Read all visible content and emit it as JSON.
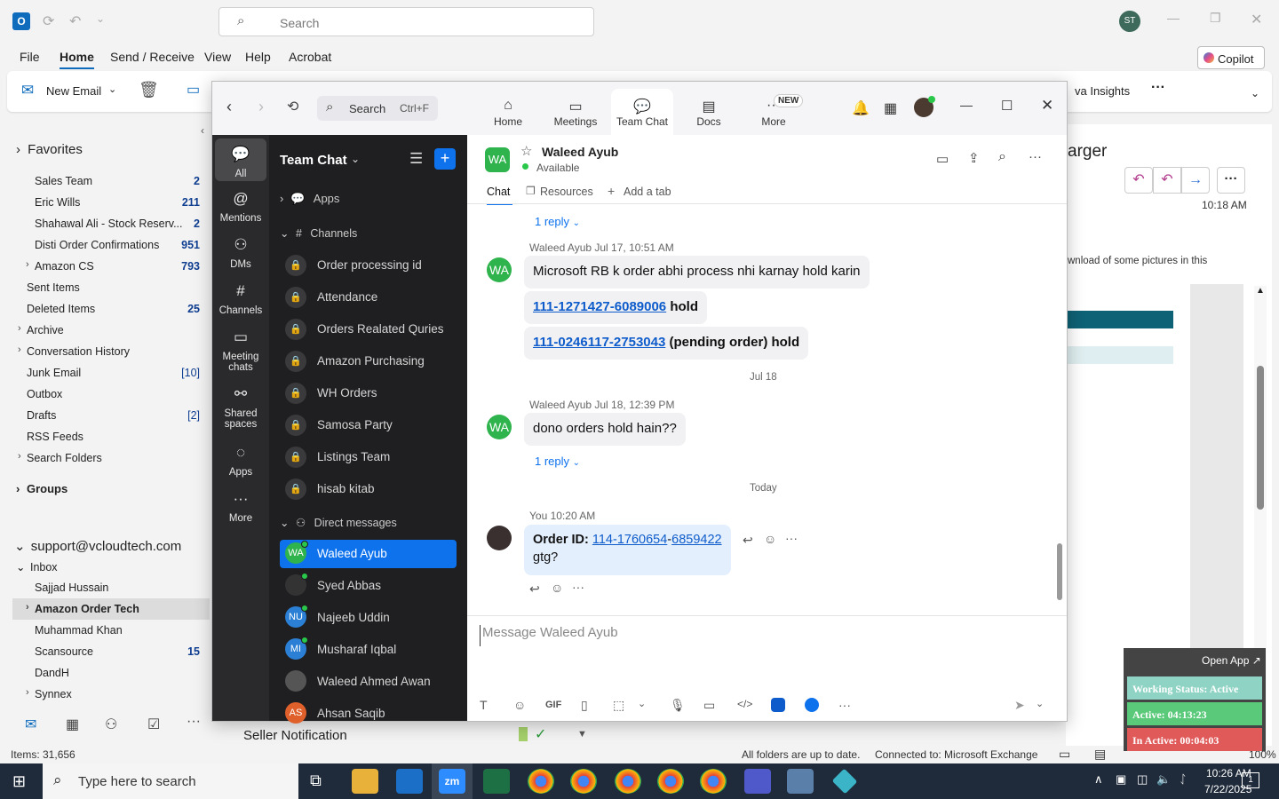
{
  "outlook": {
    "search_placeholder": "Search",
    "avatar": "ST",
    "copilot": "Copilot",
    "menu": [
      "File",
      "Home",
      "Send / Receive",
      "View",
      "Help",
      "Acrobat"
    ],
    "new_email": "New Email",
    "viva_insights": "va Insights",
    "folders_header": "Favorites",
    "favorites": [
      {
        "label": "Sales Team",
        "count": "2"
      },
      {
        "label": "Eric Wills",
        "count": "211"
      },
      {
        "label": "Shahawal Ali - Stock Reserv...",
        "count": "2"
      },
      {
        "label": "Disti Order Confirmations",
        "count": "951"
      },
      {
        "label": "Amazon CS",
        "count": "793"
      },
      {
        "label": "Sent Items",
        "count": ""
      },
      {
        "label": "Deleted Items",
        "count": "25"
      },
      {
        "label": "Archive",
        "count": ""
      },
      {
        "label": "Conversation History",
        "count": ""
      },
      {
        "label": "Junk Email",
        "count": "[10]"
      },
      {
        "label": "Outbox",
        "count": ""
      },
      {
        "label": "Drafts",
        "count": "[2]"
      },
      {
        "label": "RSS Feeds",
        "count": ""
      },
      {
        "label": "Search Folders",
        "count": ""
      }
    ],
    "groups": "Groups",
    "account": "support@vcloudtech.com",
    "inbox": "Inbox",
    "inbox_items": [
      {
        "label": "Sajjad Hussain",
        "count": ""
      },
      {
        "label": "Amazon Order Tech",
        "count": ""
      },
      {
        "label": "Muhammad Khan",
        "count": ""
      },
      {
        "label": "Scansource",
        "count": "15"
      },
      {
        "label": "DandH",
        "count": ""
      },
      {
        "label": "Synnex",
        "count": ""
      }
    ],
    "reading_title": "arger",
    "reading_time": "10:18 AM",
    "reading_text": "wnload of some pictures in this",
    "seller_notification": "Seller Notification",
    "status_items": "Items: 31,656",
    "status_folders": "All folders are up to date.",
    "status_connected": "Connected to: Microsoft Exchange",
    "zoom_pct": "100%"
  },
  "taskbar": {
    "search": "Type here to search",
    "time": "10:26 AM",
    "date": "7/22/2025",
    "notif": "1"
  },
  "zoom": {
    "search": "Search",
    "shortcut": "Ctrl+F",
    "tabs": [
      "Home",
      "Meetings",
      "Team Chat",
      "Docs",
      "More"
    ],
    "new_badge": "NEW",
    "rail": [
      "All",
      "Mentions",
      "DMs",
      "Channels",
      "Meeting chats",
      "Shared spaces",
      "Apps",
      "More"
    ],
    "list_title": "Team Chat",
    "apps": "Apps",
    "channels_header": "Channels",
    "channels": [
      "Order processing id",
      "Attendance",
      "Orders Realated Quries",
      "Amazon Purchasing",
      "WH Orders",
      "Samosa Party",
      "Listings Team",
      "hisab kitab"
    ],
    "dm_header": "Direct messages",
    "dms": [
      {
        "name": "Waleed Ayub",
        "initials": "WA",
        "color": "#2eb34d"
      },
      {
        "name": "Syed Abbas",
        "initials": "",
        "color": "#333"
      },
      {
        "name": "Najeeb Uddin",
        "initials": "NU",
        "color": "#2b7fd4"
      },
      {
        "name": "Musharaf Iqbal",
        "initials": "MI",
        "color": "#2b7fd4"
      },
      {
        "name": "Waleed Ahmed Awan",
        "initials": "",
        "color": "#555"
      },
      {
        "name": "Ahsan Saqib",
        "initials": "AS",
        "color": "#e0602b"
      }
    ],
    "contact": {
      "name": "Waleed Ayub",
      "initials": "WA",
      "status": "Available"
    },
    "chat_tabs": [
      "Chat",
      "Resources",
      "Add a tab"
    ],
    "messages": {
      "reply1": "1 reply",
      "meta1": "Waleed Ayub Jul 17, 10:51 AM",
      "text1": "Microsoft RB k order abhi process nhi karnay hold karin",
      "link2": "111-1271427-6089006",
      "text2": " hold",
      "link3": "111-0246117-2753043",
      "text3": " (pending order) hold",
      "date_jul18": "Jul 18",
      "meta4": "Waleed Ayub Jul 18, 12:39 PM",
      "text4": "dono orders hold hain??",
      "reply4": "1 reply",
      "date_today": "Today",
      "meta5": "You 10:20 AM",
      "label5": "Order ID: ",
      "link5a": "114-1760654",
      "dash5": "-",
      "link5b": "6859422",
      "text5b": "gtg?"
    },
    "composer_placeholder": "Message Waleed Ayub"
  },
  "widget": {
    "open_app": "Open App ↗",
    "working": "Working Status: Active",
    "active": "Active: 04:13:23",
    "inactive": "In Active: 00:04:03"
  }
}
